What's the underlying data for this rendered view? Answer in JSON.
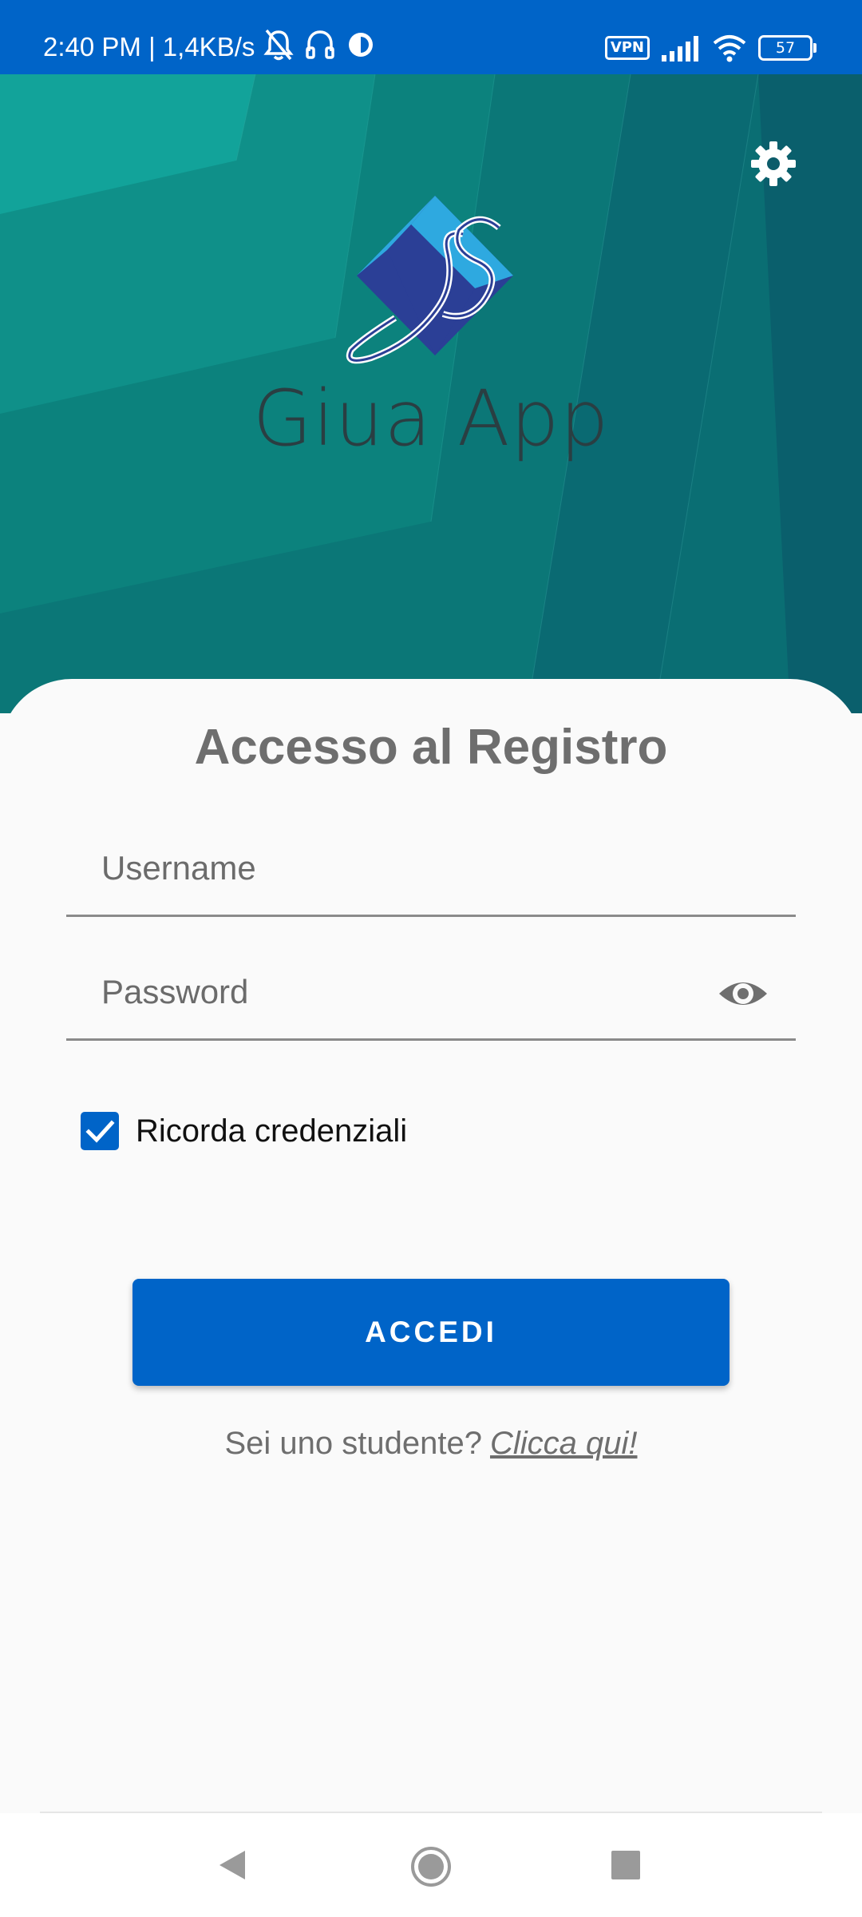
{
  "status_bar": {
    "time": "2:40 PM | 1,4KB/s",
    "vpn": "VPN",
    "battery": "57",
    "icons": [
      "notifications-off-icon",
      "headset-icon",
      "circle-status-icon",
      "signal-icon",
      "wifi-icon"
    ]
  },
  "header": {
    "app_name": "Giua App",
    "logo_text": "GS",
    "settings_icon": "gear-icon"
  },
  "login": {
    "title": "Accesso al Registro",
    "username_placeholder": "Username",
    "password_placeholder": "Password",
    "password_visibility_icon": "eye-icon",
    "remember_label": "Ricorda credenziali",
    "remember_checked": true,
    "submit_label": "ACCEDI",
    "student_prompt": "Sei uno studente?",
    "student_link": "Clicca qui!"
  },
  "nav": {
    "back": "back-icon",
    "home": "home-icon",
    "recents": "recents-icon"
  },
  "colors": {
    "primary": "#0064c8",
    "header_teal": "#0a6f74",
    "card_bg": "#fafafa",
    "title_gray": "#6e6e6e"
  }
}
